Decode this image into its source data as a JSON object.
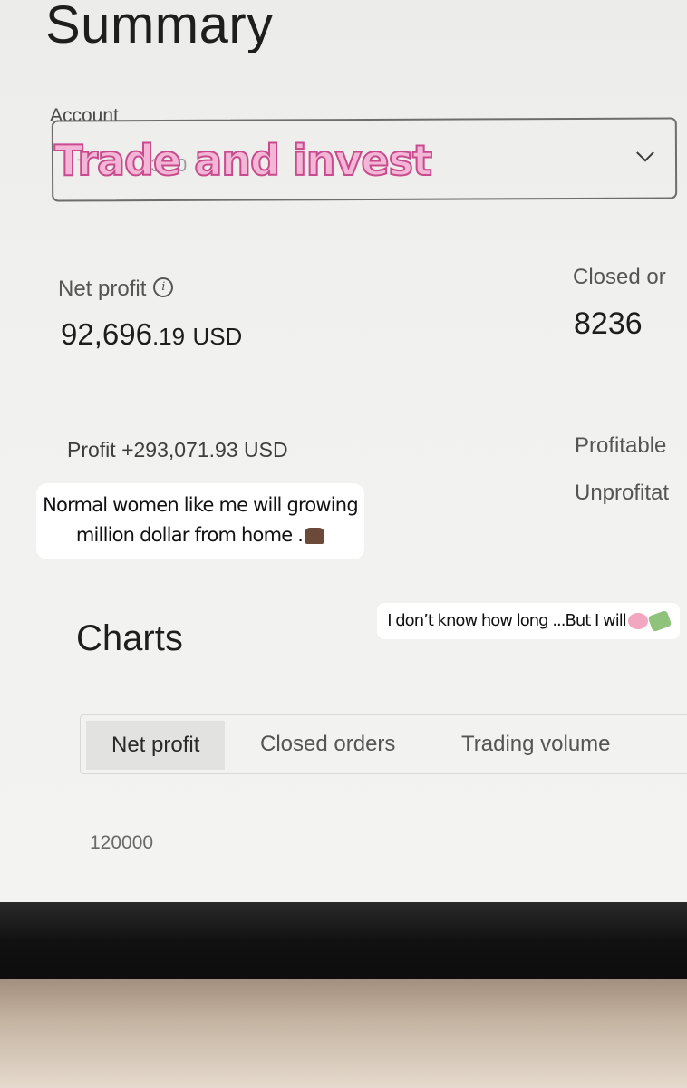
{
  "summary": {
    "title": "Summary"
  },
  "account": {
    "label": "Account",
    "selected_value": "T . 0 3 0 ."
  },
  "overlay": {
    "title": "Trade and invest"
  },
  "stats": {
    "net_profit_label": "Net profit",
    "net_profit_value_main": "92,696",
    "net_profit_value_decimals": ".19",
    "net_profit_currency": "USD",
    "closed_orders_label": "Closed or",
    "closed_orders_value": "8236",
    "profit_line": "Profit +293,071.93 USD",
    "profitable_label": "Profitable",
    "unprofitable_label": "Unprofitat"
  },
  "captions": {
    "caption1_line1": "Normal women like me will growing",
    "caption1_line2": "million dollar from home .",
    "caption2": "I don’t know how long ...But I will"
  },
  "charts": {
    "title": "Charts",
    "tabs": [
      "Net profit",
      "Closed orders",
      "Trading volume"
    ],
    "active_tab": "Net profit",
    "y_tick": "120000"
  },
  "icons": {
    "info": "info-circle-icon",
    "chevron": "chevron-down-icon"
  }
}
